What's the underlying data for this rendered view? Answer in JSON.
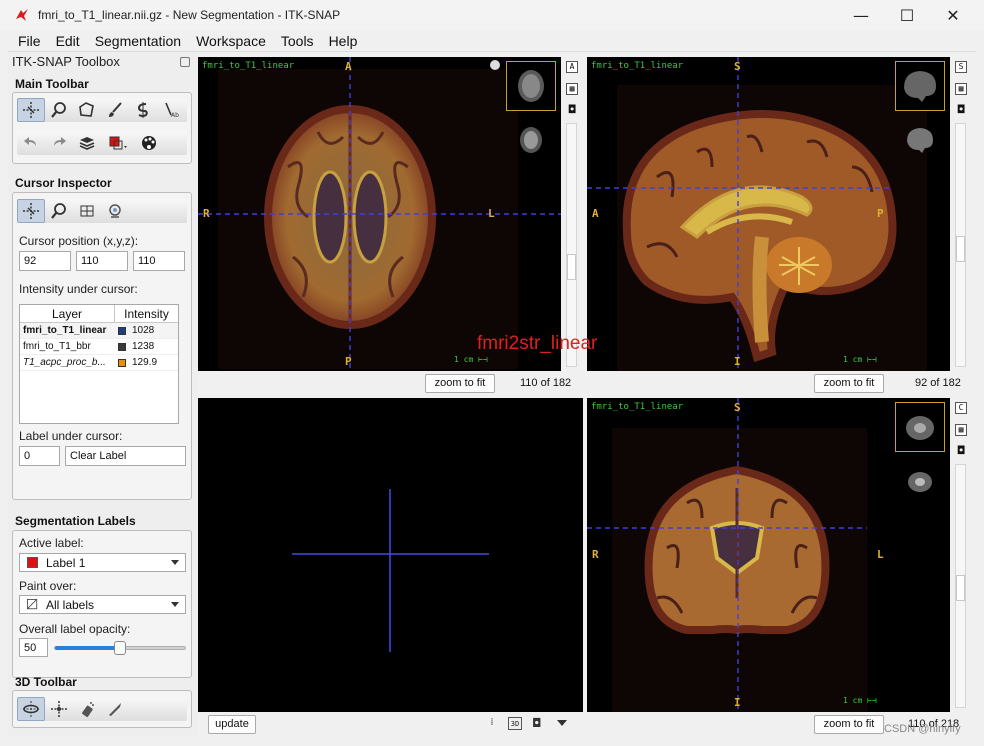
{
  "window": {
    "title": "fmri_to_T1_linear.nii.gz - New Segmentation - ITK-SNAP",
    "minimize": "—",
    "maximize": "☐",
    "close": "✕"
  },
  "menu": [
    "File",
    "Edit",
    "Segmentation",
    "Workspace",
    "Tools",
    "Help"
  ],
  "toolbox": {
    "title": "ITK-SNAP Toolbox",
    "main_toolbar_title": "Main Toolbar",
    "cursor_inspector_title": "Cursor Inspector",
    "cursor_position_label": "Cursor position (x,y,z):",
    "cursor_x": "92",
    "cursor_y": "110",
    "cursor_z": "110",
    "intensity_label": "Intensity under cursor:",
    "table_headers": [
      "Layer",
      "Intensity"
    ],
    "layers": [
      {
        "name": "fmri_to_T1_linear",
        "value": "1028",
        "color": "#1f3f7a",
        "bold": true,
        "italic": false
      },
      {
        "name": "fmri_to_T1_bbr",
        "value": "1238",
        "color": "#3a3a3a",
        "bold": false,
        "italic": false
      },
      {
        "name": "T1_acpc_proc_b...",
        "value": "129.9",
        "color": "#e8900a",
        "bold": false,
        "italic": true
      }
    ],
    "label_under_cursor_title": "Label under cursor:",
    "label_id": "0",
    "label_name": "Clear Label",
    "seg_labels_title": "Segmentation Labels",
    "active_label_title": "Active label:",
    "active_label": "Label 1",
    "active_label_color": "#e01010",
    "paint_over_title": "Paint over:",
    "paint_over": "All labels",
    "opacity_title": "Overall label opacity:",
    "opacity_value": "50",
    "opacity_fraction": 0.5,
    "toolbar3d_title": "3D Toolbar"
  },
  "views": {
    "axial": {
      "layer": "fmri_to_T1_linear",
      "top": "A",
      "bottom": "P",
      "left": "R",
      "right": "L",
      "scale": "1 cm",
      "zoom_button": "zoom to fit",
      "slice": "110 of 182"
    },
    "sagittal": {
      "layer": "fmri_to_T1_linear",
      "top": "S",
      "bottom": "I",
      "left": "A",
      "right": "P",
      "scale": "1 cm",
      "zoom_button": "zoom to fit",
      "slice": "92 of 182"
    },
    "threed": {
      "update_button": "update"
    },
    "coronal": {
      "layer": "fmri_to_T1_linear",
      "top": "S",
      "bottom": "I",
      "left": "R",
      "right": "L",
      "scale": "1 cm",
      "zoom_button": "zoom to fit",
      "slice": "110 of 218"
    }
  },
  "sidebar_buttons": {
    "axial": "A",
    "sagittal": "S",
    "coronal": "C"
  },
  "annotation": "fmri2str_linear",
  "watermark": "CSDN @hlnylfy",
  "colors": {
    "crosshair": "#3f3fdc",
    "layer_text": "#3fc93f",
    "orientation": "#e0b030",
    "annotation": "#e02020"
  }
}
